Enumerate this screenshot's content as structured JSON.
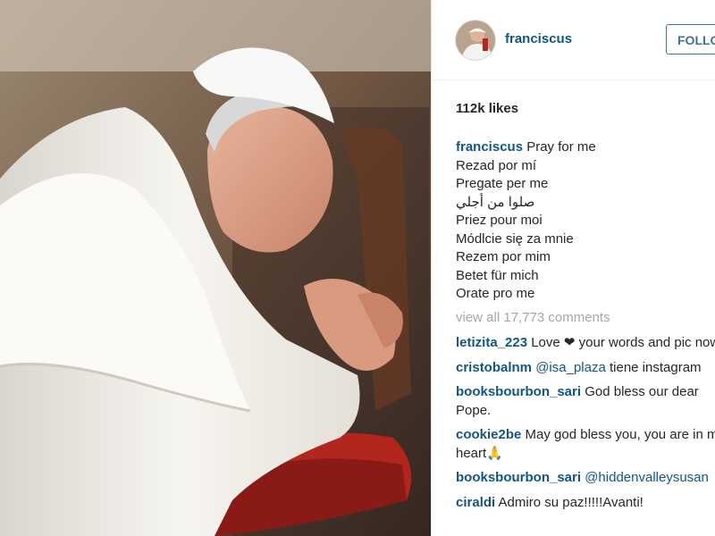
{
  "post": {
    "username": "franciscus",
    "follow_label": "FOLLOW",
    "likes": "112k likes"
  },
  "caption": {
    "username": "franciscus",
    "lines": [
      "Pray for me",
      "Rezad por mí",
      "Pregate per me",
      "صلوا من أجلي",
      "Priez pour moi",
      "Módlcie się za mnie",
      "Rezem por mim",
      "Betet für mich",
      "Orate pro me"
    ]
  },
  "view_all": "view all 17,773 comments",
  "comments": [
    {
      "user": "letizita_223",
      "text": "Love ❤ your words and pic now"
    },
    {
      "user": "cristobalnm",
      "mention": "@isa_plaza",
      "text": "tiene instagram"
    },
    {
      "user": "booksbourbon_sari",
      "text": "God bless our dear Pope."
    },
    {
      "user": "cookie2be",
      "text": "May god bless you, you are in my heart🙏"
    },
    {
      "user": "booksbourbon_sari",
      "mention": "@hiddenvalleysusan",
      "text": ""
    },
    {
      "user": "ciraldi",
      "text": "Admiro su paz!!!!!Avanti!"
    }
  ]
}
